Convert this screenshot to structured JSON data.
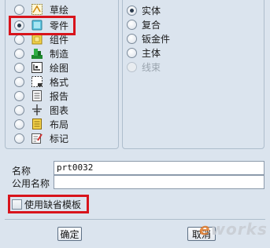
{
  "types": {
    "items": [
      {
        "label": "草绘",
        "icon": "sketch-icon",
        "selected": false
      },
      {
        "label": "零件",
        "icon": "part-icon",
        "selected": true
      },
      {
        "label": "组件",
        "icon": "assembly-icon",
        "selected": false
      },
      {
        "label": "制造",
        "icon": "manufacturing-icon",
        "selected": false
      },
      {
        "label": "绘图",
        "icon": "drawing-icon",
        "selected": false
      },
      {
        "label": "格式",
        "icon": "format-icon",
        "selected": false
      },
      {
        "label": "报告",
        "icon": "report-icon",
        "selected": false
      },
      {
        "label": "图表",
        "icon": "diagram-icon",
        "selected": false
      },
      {
        "label": "布局",
        "icon": "layout-icon",
        "selected": false
      },
      {
        "label": "标记",
        "icon": "markup-icon",
        "selected": false
      }
    ]
  },
  "subtypes": {
    "items": [
      {
        "label": "实体",
        "selected": true,
        "enabled": true
      },
      {
        "label": "复合",
        "selected": false,
        "enabled": true
      },
      {
        "label": "钣金件",
        "selected": false,
        "enabled": true
      },
      {
        "label": "主体",
        "selected": false,
        "enabled": true
      },
      {
        "label": "线束",
        "selected": false,
        "enabled": false
      }
    ]
  },
  "name_field": {
    "label": "名称",
    "value": "prt0032"
  },
  "common_name_field": {
    "label": "公用名称",
    "value": ""
  },
  "default_template": {
    "label": "使用缺省模板",
    "checked": false
  },
  "buttons": {
    "ok": "确定",
    "cancel": "取消"
  },
  "watermark": {
    "e": "e",
    "rest": "works"
  },
  "colors": {
    "highlight": "#d8141c",
    "background": "#dbe4ee"
  }
}
